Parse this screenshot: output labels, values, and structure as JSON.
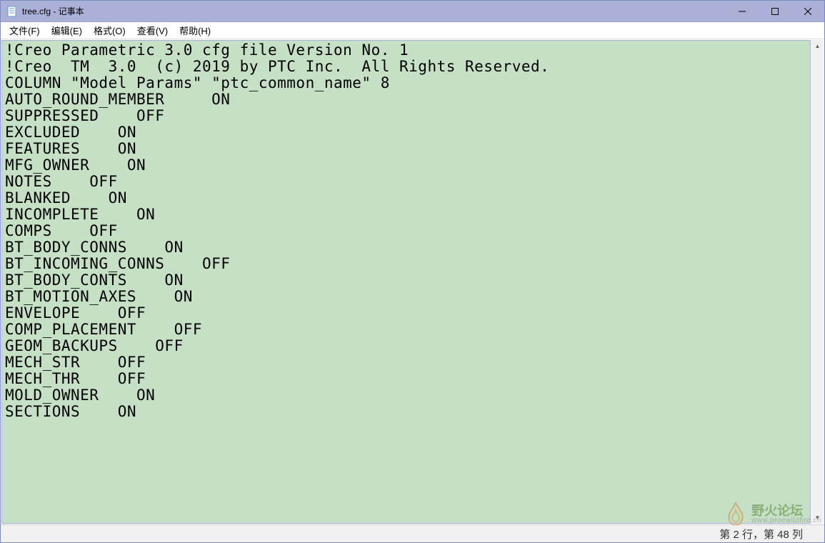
{
  "window": {
    "title": "tree.cfg - 记事本"
  },
  "menu": {
    "file": "文件(F)",
    "edit": "编辑(E)",
    "format": "格式(O)",
    "view": "查看(V)",
    "help": "帮助(H)"
  },
  "content": {
    "text": "!Creo Parametric 3.0 cfg file Version No. 1\n!Creo  TM  3.0  (c) 2019 by PTC Inc.  All Rights Reserved.\nCOLUMN \"Model Params\" \"ptc_common_name\" 8\nAUTO_ROUND_MEMBER     ON\nSUPPRESSED    OFF\nEXCLUDED    ON\nFEATURES    ON\nMFG_OWNER    ON\nNOTES    OFF\nBLANKED    ON\nINCOMPLETE    ON\nCOMPS    OFF\nBT_BODY_CONNS    ON\nBT_INCOMING_CONNS    OFF\nBT_BODY_CONTS    ON\nBT_MOTION_AXES    ON\nENVELOPE    OFF\nCOMP_PLACEMENT    OFF\nGEOM_BACKUPS    OFF\nMECH_STR    OFF\nMECH_THR    OFF\nMOLD_OWNER    ON\nSECTIONS    ON"
  },
  "status": {
    "position": "第 2 行，第 48 列"
  },
  "watermark": {
    "cn": "野火论坛",
    "url": "www.proewildfire.cn"
  }
}
